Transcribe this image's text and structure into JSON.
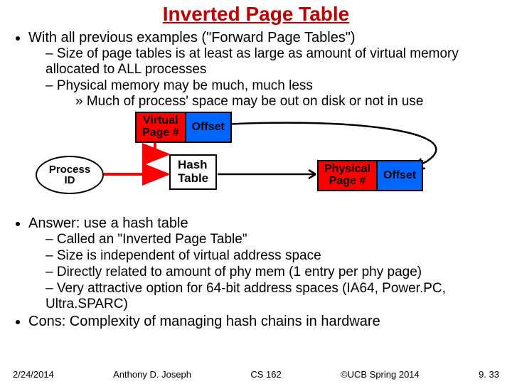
{
  "title": "Inverted Page Table",
  "bullets": {
    "l1a": "With all previous examples (\"Forward Page Tables\")",
    "l2a": "Size of page tables is at least as large as amount of virtual memory allocated to ALL processes",
    "l2b": "Physical memory may be much, much less",
    "l3a": "Much of process' space may be out on disk or not in use",
    "l1b": "Answer: use a hash table",
    "l2c": "Called an \"Inverted Page Table\"",
    "l2d": "Size is independent of virtual address space",
    "l2e": "Directly related to amount of phy mem (1 entry per phy page)",
    "l2f": "Very attractive option for 64-bit address spaces (IA64, Power.PC, Ultra.SPARC)",
    "l1c": "Cons: Complexity of managing hash chains in hardware"
  },
  "diagram": {
    "process_id": "Process\nID",
    "virtual_page": "Virtual\nPage #",
    "offset1": "Offset",
    "hash_table": "Hash\nTable",
    "physical_page": "Physical\nPage #",
    "offset2": "Offset"
  },
  "footer": {
    "date": "2/24/2014",
    "author": "Anthony D. Joseph",
    "course": "CS 162",
    "copyright": "©UCB Spring 2014",
    "page": "9. 33"
  }
}
